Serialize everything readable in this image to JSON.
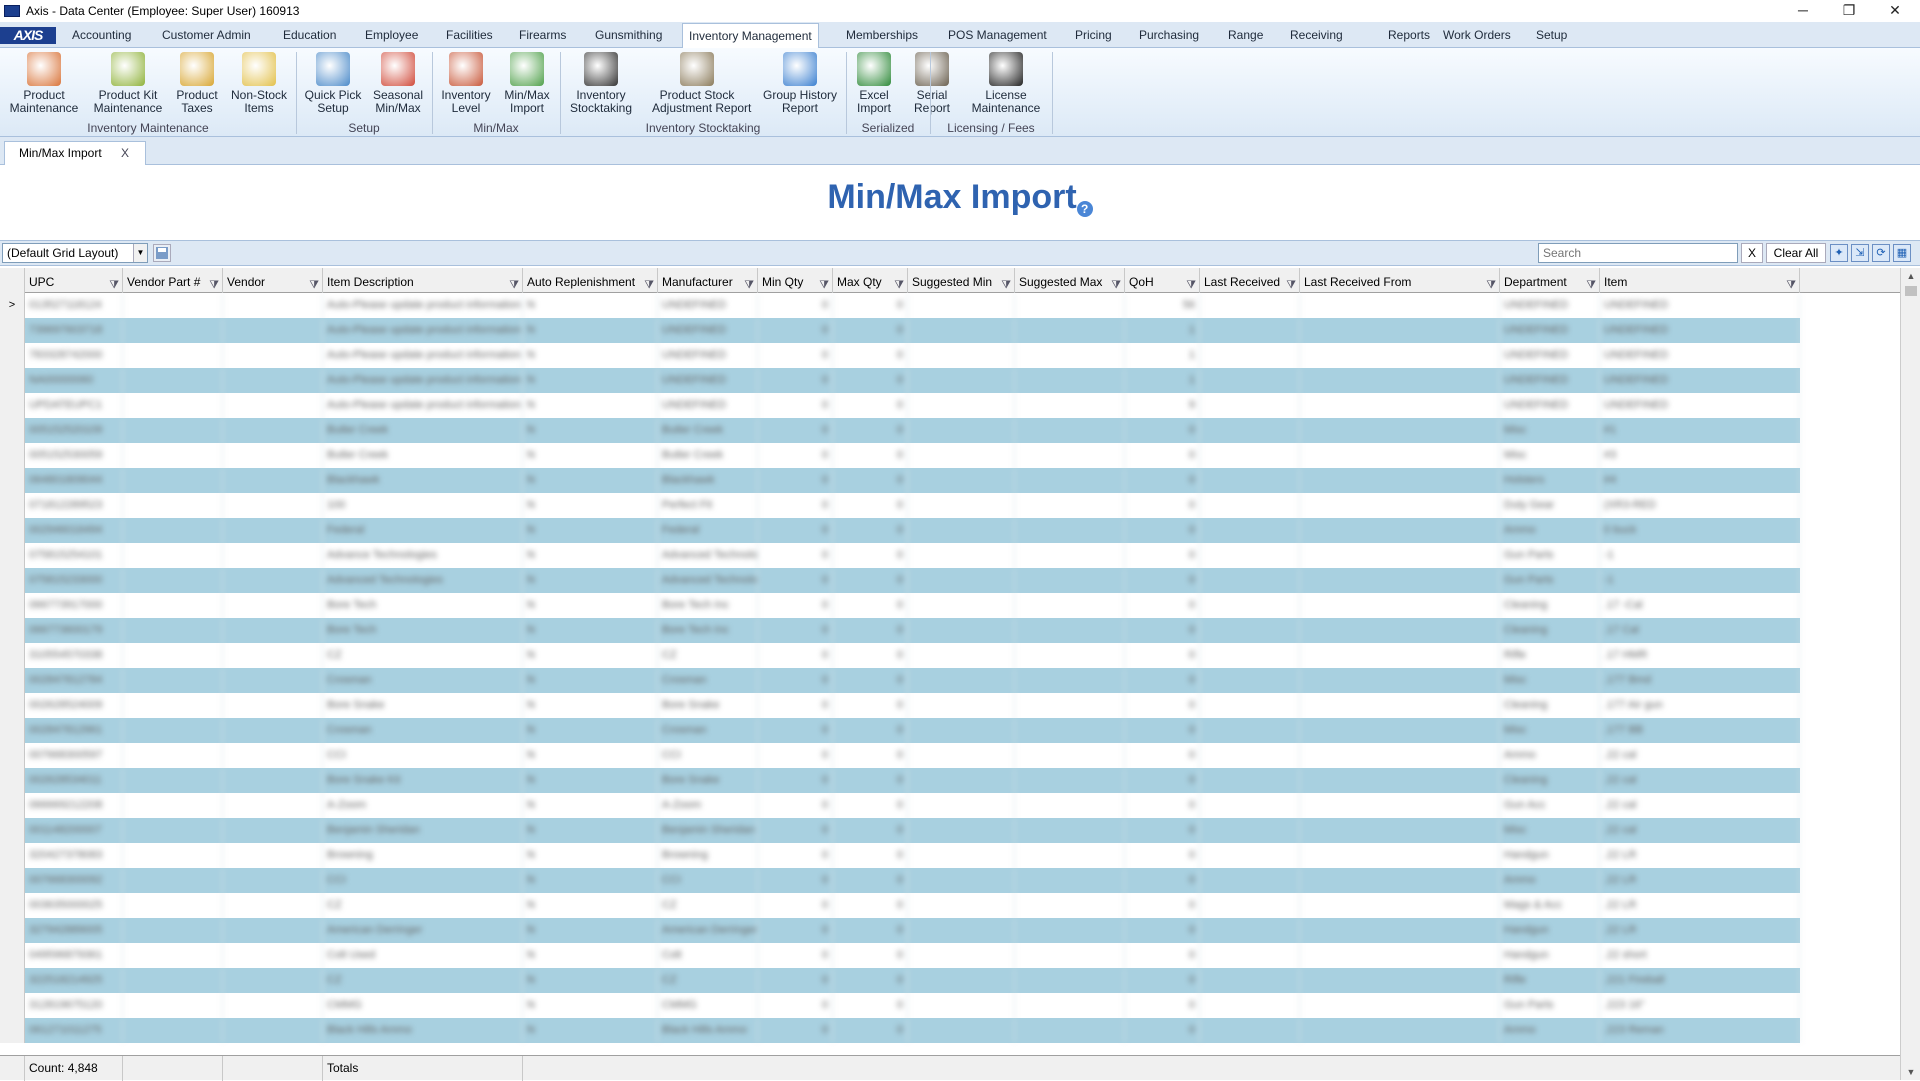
{
  "window": {
    "title": "Axis - Data Center  (Employee: Super User) 160913",
    "minimize": "─",
    "restore": "❐",
    "close": "✕"
  },
  "logo_text": "AXIS",
  "menu": [
    "Accounting",
    "Customer Admin",
    "Education",
    "Employee",
    "Facilities",
    "Firearms",
    "Gunsmithing",
    "Inventory Management",
    "Memberships",
    "POS Management",
    "Pricing",
    "Purchasing",
    "Range",
    "Receiving",
    "Reports",
    "Work Orders",
    "Setup"
  ],
  "ribbon": {
    "buttons": [
      {
        "name": "product-maintenance",
        "l1": "Product",
        "l2": "Maintenance",
        "color": "#d9743a"
      },
      {
        "name": "product-kit-maintenance",
        "l1": "Product Kit",
        "l2": "Maintenance",
        "color": "#8fb23a"
      },
      {
        "name": "product-taxes",
        "l1": "Product",
        "l2": "Taxes",
        "color": "#d8a632"
      },
      {
        "name": "non-stock-items",
        "l1": "Non-Stock",
        "l2": "Items",
        "color": "#e2c04a"
      },
      {
        "name": "quick-pick-setup",
        "l1": "Quick Pick",
        "l2": "Setup",
        "color": "#4b8ac9"
      },
      {
        "name": "seasonal-min-max",
        "l1": "Seasonal",
        "l2": "Min/Max",
        "color": "#d04a3a"
      },
      {
        "name": "inventory-level",
        "l1": "Inventory",
        "l2": "Level",
        "color": "#c8583a"
      },
      {
        "name": "min-max-import",
        "l1": "Min/Max",
        "l2": "Import",
        "color": "#4fa04a"
      },
      {
        "name": "inventory-stocktaking",
        "l1": "Inventory",
        "l2": "Stocktaking",
        "color": "#333333"
      },
      {
        "name": "product-stock-adjustment-report",
        "l1": "Product Stock",
        "l2": "Adjustment Report",
        "color": "#8a7a5a"
      },
      {
        "name": "group-history-report",
        "l1": "Group History",
        "l2": "Report",
        "color": "#3a7fd0"
      },
      {
        "name": "excel-import",
        "l1": "Excel",
        "l2": "Import",
        "color": "#2f8a3a"
      },
      {
        "name": "serial-report",
        "l1": "Serial",
        "l2": "Report",
        "color": "#6a6050"
      },
      {
        "name": "license-maintenance",
        "l1": "License",
        "l2": "Maintenance",
        "color": "#222222"
      }
    ],
    "groups": [
      "Inventory Maintenance",
      "Setup",
      "Min/Max",
      "Inventory Stocktaking",
      "Serialized",
      "Licensing / Fees"
    ]
  },
  "tab": {
    "label": "Min/Max Import",
    "close": "X"
  },
  "page_title": "Min/Max Import",
  "help_glyph": "?",
  "toolbar": {
    "layout": "(Default Grid Layout)",
    "search_placeholder": "Search",
    "clear_x": "X",
    "clear_all": "Clear All"
  },
  "grid": {
    "columns": [
      "UPC",
      "Vendor Part #",
      "Vendor",
      "Item Description",
      "Auto Replenishment",
      "Manufacturer",
      "Min Qty",
      "Max Qty",
      "Suggested Min",
      "Suggested Max",
      "QoH",
      "Last Received",
      "Last Received From",
      "Department",
      "Item"
    ],
    "rows": [
      [
        "013527118124",
        "",
        "",
        "Auto-Please update product information",
        "N",
        "UNDEFINED",
        "0",
        "0",
        "",
        "",
        "56",
        "",
        "",
        "UNDEFINED",
        "UNDEFINED"
      ],
      [
        "739697603718",
        "",
        "",
        "Auto-Please update product information",
        "N",
        "UNDEFINED",
        "0",
        "0",
        "",
        "",
        "1",
        "",
        "",
        "UNDEFINED",
        "UNDEFINED"
      ],
      [
        "783328742000",
        "",
        "",
        "Auto-Please update product information",
        "N",
        "UNDEFINED",
        "0",
        "0",
        "",
        "",
        "1",
        "",
        "",
        "UNDEFINED",
        "UNDEFINED"
      ],
      [
        "NA00000060",
        "",
        "",
        "Auto-Please update product information",
        "N",
        "UNDEFINED",
        "0",
        "0",
        "",
        "",
        "1",
        "",
        "",
        "UNDEFINED",
        "UNDEFINED"
      ],
      [
        "UPDATEUPC1",
        "",
        "",
        "Auto-Please update product information",
        "N",
        "UNDEFINED",
        "0",
        "0",
        "",
        "",
        "9",
        "",
        "",
        "UNDEFINED",
        "UNDEFINED"
      ],
      [
        "005152520109",
        "",
        "",
        "Butler Creek",
        "N",
        "Butler Creek",
        "0",
        "0",
        "",
        "",
        "0",
        "",
        "",
        "Misc",
        "#1"
      ],
      [
        "005152530059",
        "",
        "",
        "Butler Creek",
        "N",
        "Butler Creek",
        "0",
        "0",
        "",
        "",
        "0",
        "",
        "",
        "Misc",
        "#3"
      ],
      [
        "064801809044",
        "",
        "",
        "Blackhawk",
        "N",
        "Blackhawk",
        "0",
        "0",
        "",
        "",
        "0",
        "",
        "",
        "Holsters",
        "#4"
      ],
      [
        "071812289523",
        "",
        "",
        "100",
        "N",
        "Perfect Fit",
        "0",
        "0",
        "",
        "",
        "0",
        "",
        "",
        "Duty Gear",
        "(XR3-RED"
      ],
      [
        "002946016494",
        "",
        "",
        "Federal",
        "N",
        "Federal",
        "0",
        "0",
        "",
        "",
        "0",
        "",
        "",
        "Ammo",
        "0 buck"
      ],
      [
        "075815254101",
        "",
        "",
        "Advance Technologies",
        "N",
        "Advanced Technologies",
        "0",
        "0",
        "",
        "",
        "0",
        "",
        "",
        "Gun Parts",
        "-1"
      ],
      [
        "075815233000",
        "",
        "",
        "Advanced Technologies",
        "N",
        "Advanced Technologies",
        "0",
        "0",
        "",
        "",
        "0",
        "",
        "",
        "Gun Parts",
        "-1"
      ],
      [
        "066773917000",
        "",
        "",
        "Bore Tech",
        "N",
        "Bore Tech Inc",
        "0",
        "0",
        "",
        "",
        "0",
        "",
        "",
        "Cleaning",
        ".17 -Cal"
      ],
      [
        "066773600179",
        "",
        "",
        "Bore Tech",
        "N",
        "Bore Tech Inc",
        "0",
        "0",
        "",
        "",
        "0",
        "",
        "",
        "Cleaning",
        ".17 Cal"
      ],
      [
        "310554570338",
        "",
        "",
        "CZ",
        "N",
        "CZ",
        "0",
        "0",
        "",
        "",
        "0",
        "",
        "",
        "Rifle",
        ".17 HMR"
      ],
      [
        "002847812784",
        "",
        "",
        "Crosman",
        "N",
        "Crosman",
        "0",
        "0",
        "",
        "",
        "0",
        "",
        "",
        "Misc",
        ".177 Bmd"
      ],
      [
        "002628524009",
        "",
        "",
        "Bore Snake",
        "N",
        "Bore Snake",
        "0",
        "0",
        "",
        "",
        "0",
        "",
        "",
        "Cleaning",
        ".177 Air gun"
      ],
      [
        "002847812961",
        "",
        "",
        "Crosman",
        "N",
        "Crosman",
        "0",
        "0",
        "",
        "",
        "0",
        "",
        "",
        "Misc",
        ".177 BB"
      ],
      [
        "007668300597",
        "",
        "",
        "CCI",
        "N",
        "CCI",
        "0",
        "0",
        "",
        "",
        "0",
        "",
        "",
        "Ammo",
        ".22 cal"
      ],
      [
        "002628534011",
        "",
        "",
        "Bore Snake Kit",
        "N",
        "Bore Snake",
        "0",
        "0",
        "",
        "",
        "0",
        "",
        "",
        "Cleaning",
        ".22 cal"
      ],
      [
        "066669212208",
        "",
        "",
        "A-Zoom",
        "N",
        "A-Zoom",
        "0",
        "0",
        "",
        "",
        "0",
        "",
        "",
        "Gun Acc",
        ".22 cal"
      ],
      [
        "001148200007",
        "",
        "",
        "Benjamin Sheridan",
        "N",
        "Benjamin Sheridan",
        "0",
        "0",
        "",
        "",
        "0",
        "",
        "",
        "Misc",
        ".22 cal"
      ],
      [
        "320427378083",
        "",
        "",
        "Browning",
        "N",
        "Browning",
        "0",
        "0",
        "",
        "",
        "0",
        "",
        "",
        "Handgun",
        ".22 LR"
      ],
      [
        "007668300092",
        "",
        "",
        "CCI",
        "N",
        "CCI",
        "0",
        "0",
        "",
        "",
        "0",
        "",
        "",
        "Ammo",
        ".22 LR"
      ],
      [
        "003635000025",
        "",
        "",
        "CZ",
        "N",
        "CZ",
        "0",
        "0",
        "",
        "",
        "0",
        "",
        "",
        "Mags & Acc",
        ".22 LR"
      ],
      [
        "327942889005",
        "",
        "",
        "American Derringer",
        "N",
        "American Derringer",
        "0",
        "0",
        "",
        "",
        "0",
        "",
        "",
        "Handgun",
        ".22 LR"
      ],
      [
        "049596879361",
        "",
        "",
        "Colt Used",
        "N",
        "Colt",
        "0",
        "0",
        "",
        "",
        "0",
        "",
        "",
        "Handgun",
        ".22 short"
      ],
      [
        "322518214925",
        "",
        "",
        "CZ",
        "N",
        "CZ",
        "0",
        "0",
        "",
        "",
        "0",
        "",
        "",
        "Rifle",
        ".221 Fireball"
      ],
      [
        "312819675120",
        "",
        "",
        "CMMG",
        "N",
        "CMMG",
        "0",
        "0",
        "",
        "",
        "0",
        "",
        "",
        "Gun Parts",
        ".223 16\""
      ],
      [
        "061271011275",
        "",
        "",
        "Black Hills Ammo",
        "N",
        "Black Hills Ammo",
        "0",
        "0",
        "",
        "",
        "0",
        "",
        "",
        "Ammo",
        ".223 Reman"
      ]
    ]
  },
  "footer": {
    "count": "Count: 4,848",
    "totals": "Totals"
  }
}
